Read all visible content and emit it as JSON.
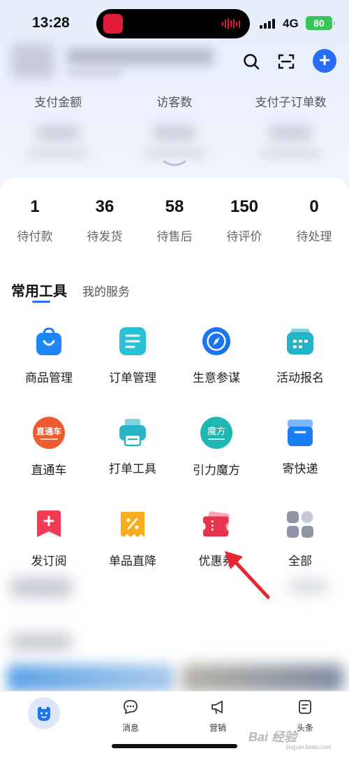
{
  "status_bar": {
    "time": "13:28",
    "network": "4G",
    "battery": "80"
  },
  "metrics": [
    {
      "label": "支付金额"
    },
    {
      "label": "访客数"
    },
    {
      "label": "支付子订单数"
    }
  ],
  "orders": [
    {
      "count": "1",
      "label": "待付款"
    },
    {
      "count": "36",
      "label": "待发货"
    },
    {
      "count": "58",
      "label": "待售后"
    },
    {
      "count": "150",
      "label": "待评价"
    },
    {
      "count": "0",
      "label": "待处理"
    }
  ],
  "tabs": {
    "active": "常用工具",
    "other": "我的服务"
  },
  "tools": [
    {
      "label": "商品管理",
      "icon": "shopping-bag-icon"
    },
    {
      "label": "订单管理",
      "icon": "order-list-icon"
    },
    {
      "label": "生意参谋",
      "icon": "compass-icon"
    },
    {
      "label": "活动报名",
      "icon": "activity-calendar-icon"
    },
    {
      "label": "直通车",
      "icon": "zhitongche-icon",
      "badge": "直通车"
    },
    {
      "label": "打单工具",
      "icon": "printer-icon"
    },
    {
      "label": "引力魔方",
      "icon": "magic-cube-icon",
      "badge": "魔方"
    },
    {
      "label": "寄快递",
      "icon": "express-box-icon"
    },
    {
      "label": "发订阅",
      "icon": "subscribe-icon"
    },
    {
      "label": "单品直降",
      "icon": "discount-icon"
    },
    {
      "label": "优惠券",
      "icon": "coupon-icon"
    },
    {
      "label": "全部",
      "icon": "all-apps-icon"
    }
  ],
  "bottom_nav": [
    {
      "label": "消息",
      "icon": "message-icon"
    },
    {
      "label": "营销",
      "icon": "megaphone-icon"
    },
    {
      "label": "头条",
      "icon": "news-icon"
    }
  ],
  "watermark": {
    "text": "Bai 经验",
    "sub": "jingyan.baidu.com"
  },
  "colors": {
    "accent": "#2a6df5",
    "arrow": "#e8262f"
  }
}
